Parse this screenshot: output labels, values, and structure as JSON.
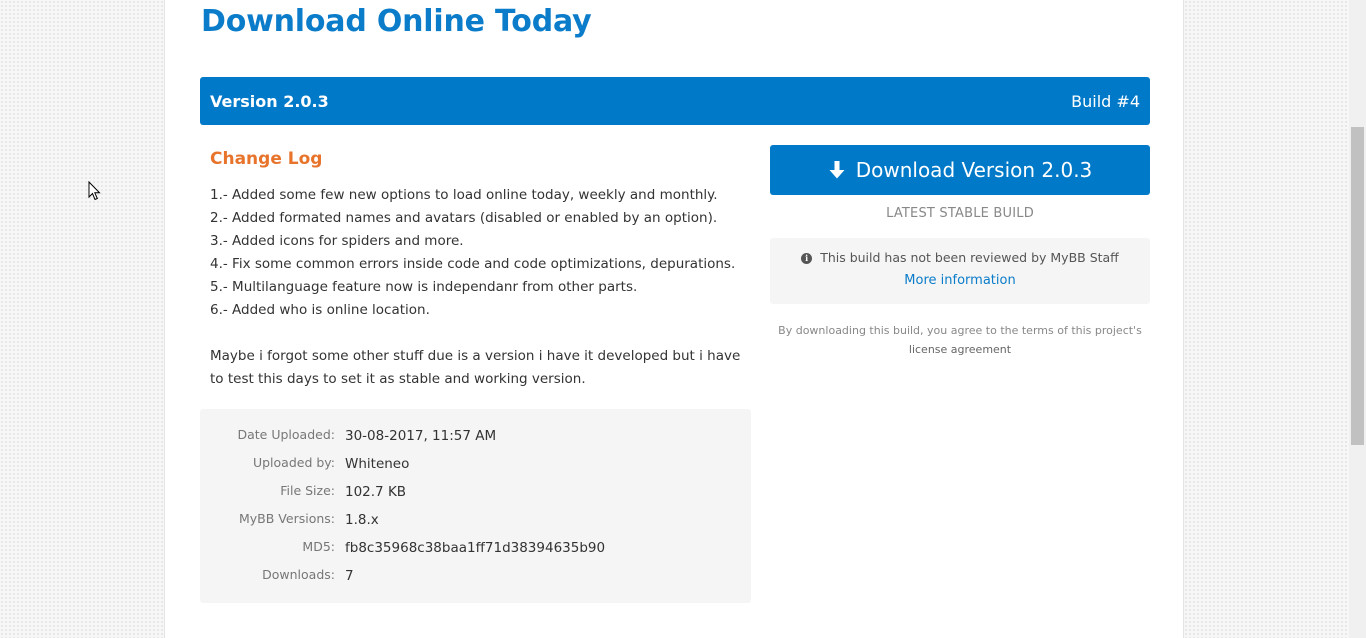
{
  "page": {
    "title": "Download Online Today"
  },
  "version_bar": {
    "version": "Version 2.0.3",
    "build": "Build #4"
  },
  "changelog": {
    "title": "Change Log",
    "items": [
      "1.- Added some few new options to load online today, weekly and monthly.",
      "2.- Added formated names and avatars (disabled or enabled by an option).",
      "3.- Added icons for spiders and more.",
      "4.- Fix some common errors inside code and code optimizations, depurations.",
      "5.- Multilanguage feature now is independanr from other parts.",
      "6.- Added who is online location."
    ],
    "note": "Maybe i forgot some other stuff due is a version i have it developed but i have to test this days to set it as stable and working version."
  },
  "details": {
    "rows": [
      {
        "label": "Date Uploaded:",
        "value": "30-08-2017, 11:57 AM"
      },
      {
        "label": "Uploaded by:",
        "value": "Whiteneo"
      },
      {
        "label": "File Size:",
        "value": "102.7 KB"
      },
      {
        "label": "MyBB Versions:",
        "value": "1.8.x"
      },
      {
        "label": "MD5:",
        "value": "fb8c35968c38baa1ff71d38394635b90"
      },
      {
        "label": "Downloads:",
        "value": "7"
      }
    ]
  },
  "download": {
    "button_label": "Download Version 2.0.3",
    "icon": "arrow-down-icon",
    "subtitle": "LATEST STABLE BUILD"
  },
  "review": {
    "icon": "info-icon",
    "message": "This build has not been reviewed by MyBB Staff",
    "link_label": "More information"
  },
  "agreement": {
    "text": "By downloading this build, you agree to the terms of this project's",
    "link_label": "license agreement"
  },
  "colors": {
    "brand_blue": "#0079c9",
    "title_blue": "#0a7cc9",
    "changelog_orange": "#e8742c"
  }
}
